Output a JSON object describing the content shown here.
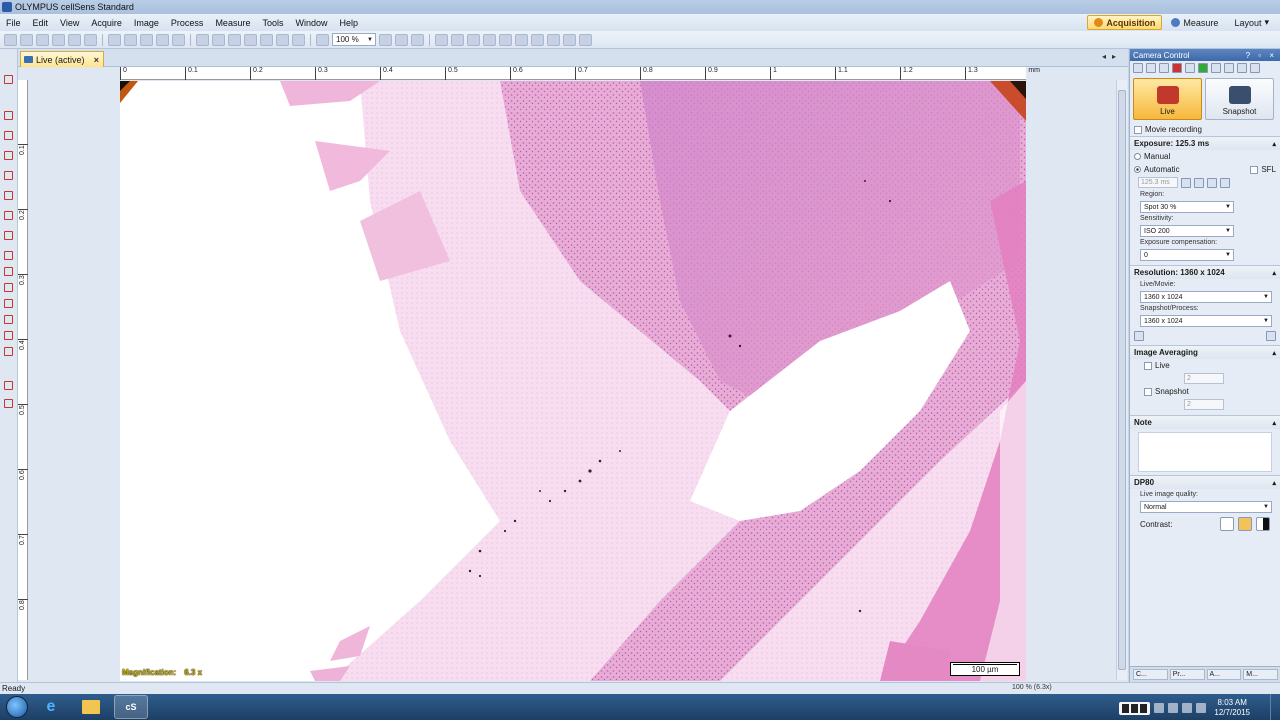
{
  "window": {
    "title": "OLYMPUS cellSens Standard"
  },
  "menu": [
    "File",
    "Edit",
    "View",
    "Acquire",
    "Image",
    "Process",
    "Measure",
    "Tools",
    "Window",
    "Help"
  ],
  "modes": {
    "acquisition": "Acquisition",
    "measure": "Measure",
    "layout": "Layout"
  },
  "toolbar": {
    "zoom_value": "100 %"
  },
  "document": {
    "tab_label": "Live (active)"
  },
  "ruler": {
    "h_ticks": [
      "0",
      "0.1",
      "0.2",
      "0.3",
      "0.4",
      "0.5",
      "0.6",
      "0.7",
      "0.8",
      "0.9",
      "1",
      "1.1",
      "1.2",
      "1.3"
    ],
    "v_ticks": [
      "0.1",
      "0.2",
      "0.3",
      "0.4",
      "0.5",
      "0.6",
      "0.7",
      "0.8"
    ],
    "unit": "mm"
  },
  "image": {
    "magnification_label": "Magnification:",
    "magnification_value": "6.3 x",
    "scalebar": "100 µm"
  },
  "panel": {
    "title": "Camera Control",
    "live_button": "Live",
    "snapshot_button": "Snapshot",
    "movie_recording": "Movie recording",
    "exposure_title": "Exposure: 125.3 ms",
    "manual": "Manual",
    "automatic": "Automatic",
    "sfl": "SFL",
    "exposure_value": "125.3 ms",
    "region_label": "Region:",
    "region_value": "Spot 30 %",
    "sensitivity_label": "Sensitivity:",
    "sensitivity_value": "ISO 200",
    "exp_comp_label": "Exposure compensation:",
    "exp_comp_value": "0",
    "resolution_title": "Resolution: 1360 x 1024",
    "live_movie_label": "Live/Movie:",
    "live_movie_value": "1360 x 1024",
    "snapshot_process_label": "Snapshot/Process:",
    "snapshot_process_value": "1360 x 1024",
    "averaging_title": "Image Averaging",
    "avg_live": "Live",
    "avg_live_frames": "2",
    "avg_snapshot": "Snapshot",
    "avg_snapshot_frames": "2",
    "note_title": "Note",
    "dp80_title": "DP80",
    "live_quality_label": "Live image quality:",
    "live_quality_value": "Normal",
    "contrast_label": "Contrast:",
    "tabs": [
      "C...",
      "Pr...",
      "A...",
      "M..."
    ]
  },
  "status": {
    "text": "Ready",
    "zoom": "100 % (6.3x)"
  },
  "clock": {
    "time": "8:03 AM",
    "date": "12/7/2015"
  },
  "taskbar": {
    "cs_label": "cS"
  },
  "colors": {
    "tissue_pink": "#e9a8d4",
    "tissue_purple": "#b96cc0",
    "accent_orange": "#f7b83b"
  }
}
